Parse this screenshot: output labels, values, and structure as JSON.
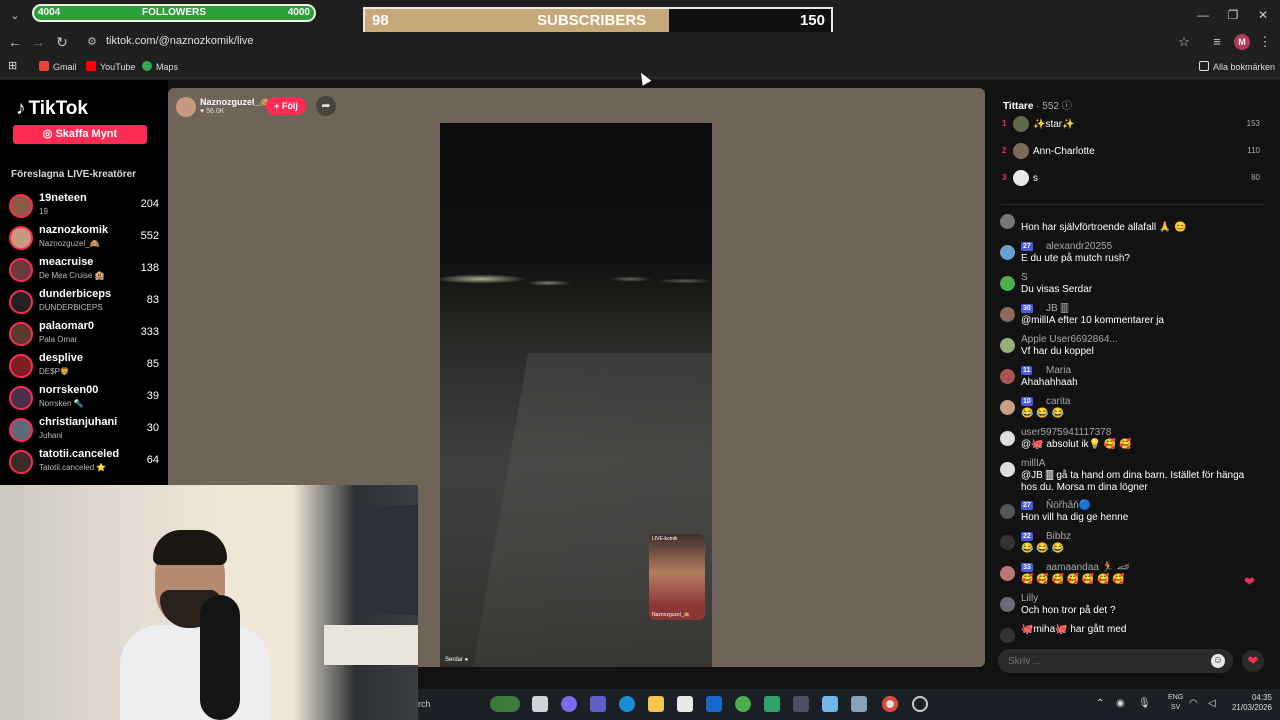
{
  "browser": {
    "url": "tiktok.com/@naznozkomik/live",
    "bookmarks": [
      {
        "label": "Gmail",
        "icon": "gmail-icon",
        "color": "#ea4335"
      },
      {
        "label": "YouTube",
        "icon": "youtube-icon",
        "color": "#ff0000"
      },
      {
        "label": "Maps",
        "icon": "maps-icon",
        "color": "#34a853"
      }
    ],
    "all_bookmarks": "Alla bokmärken",
    "profile_letter": "M"
  },
  "overlay": {
    "followers": {
      "current": "4004",
      "label": "FOLLOWERS",
      "goal": "4000"
    },
    "subscribers": {
      "current": "98",
      "label": "SUBSCRIBERS",
      "goal": "150",
      "progress": 0.653
    }
  },
  "tiktok": {
    "logo": "TikTok",
    "coins_button": "Skaffa Mynt",
    "suggested_title": "Föreslagna LIVE-kreatörer",
    "creators": [
      {
        "name": "19neteen",
        "sub": "19",
        "count": "204"
      },
      {
        "name": "naznozkomik",
        "sub": "Naznozguzel_🙈",
        "count": "552"
      },
      {
        "name": "meacruise",
        "sub": "De Mea Cruise 🏨",
        "count": "138"
      },
      {
        "name": "dunderbiceps",
        "sub": "DUNDERBICEPS",
        "count": "83"
      },
      {
        "name": "palaomar0",
        "sub": "Pala Omar",
        "count": "333"
      },
      {
        "name": "desplive",
        "sub": "DE$P🦁",
        "count": "85"
      },
      {
        "name": "norrsken00",
        "sub": "Norrsken 🔦",
        "count": "39"
      },
      {
        "name": "christianjuhani",
        "sub": "Juhani",
        "count": "30"
      },
      {
        "name": "tatotii.canceled",
        "sub": "Tatotii.canceled ⭐",
        "count": "64"
      }
    ],
    "host": {
      "name": "Naznozguzel_🙈",
      "likes": "56.0K",
      "follow": "+ Följ"
    },
    "video_user": "Serdar ●",
    "pip_label": "LIVE-komik",
    "pip_name": "Naznozguzel_🙈",
    "viewers": {
      "title": "Tittare",
      "count": "· 552"
    },
    "top_viewers": [
      {
        "rank": "1",
        "name": "✨star✨",
        "score": "153"
      },
      {
        "rank": "2",
        "name": "Ann-Charlotte",
        "score": "110"
      },
      {
        "rank": "3",
        "name": "s",
        "score": "80"
      }
    ],
    "messages": [
      {
        "user": "Hon har självförtroende allafall 🙏 😊",
        "text": "",
        "badge": "",
        "partial": true
      },
      {
        "user": "alexandr20255",
        "text": "E du ute på mutch rush?",
        "badge": "27"
      },
      {
        "user": "S",
        "text": "Du visas Serdar",
        "badge": ""
      },
      {
        "user": "JB 🀫",
        "text": "@millIA efter 10 kommentarer ja",
        "badge": "30"
      },
      {
        "user": "Apple User6692864...",
        "text": "Vf har du koppel",
        "badge": ""
      },
      {
        "user": "Maria",
        "text": "Ahahahhaah",
        "badge": "11"
      },
      {
        "user": "carita",
        "text": "😂 😂 😂",
        "badge": "10"
      },
      {
        "user": "user5975941117378",
        "text": "@🐙 absolut ik💡 🥰 🥰",
        "badge": ""
      },
      {
        "user": "millIA",
        "text": "@JB 🀫 gå ta hand om dina barn. Istället för hänga",
        "text2": "hos du. Morsa m dina lögner",
        "badge": ""
      },
      {
        "user": "Ňöřhãň🔵",
        "text": "Hon vill ha dig ge henne",
        "badge": "27"
      },
      {
        "user": "Bibbz",
        "text": "😂 😂 😂",
        "badge": "22"
      },
      {
        "user": "aamaandaa 🏃 🏎",
        "text": "🥰 🥰 🥰 🥰 🥰 🥰 🥰",
        "badge": "33"
      },
      {
        "user": "Lilly",
        "text": "Och hon tror på det ?",
        "badge": ""
      },
      {
        "user": "🐙miha🐙  har gått med",
        "text": "",
        "badge": ""
      }
    ],
    "input_placeholder": "Skriv ..."
  },
  "taskbar": {
    "search": "rch",
    "lang_top": "ENG",
    "lang_bottom": "SV",
    "time": "04:35",
    "date": "21/03/2026"
  }
}
